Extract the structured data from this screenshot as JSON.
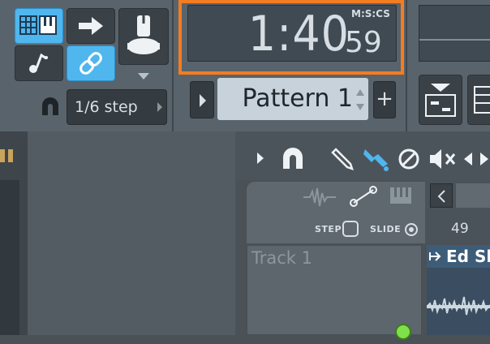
{
  "toolbar": {
    "snap_value": "1/6 step",
    "time_display": {
      "main": "1:40",
      "sub": "59",
      "format": "M:S:CS"
    },
    "pattern": {
      "label": "Pattern 1",
      "add_label": "+"
    }
  },
  "tool_panel": {
    "step_label": "STEP",
    "slide_label": "SLIDE"
  },
  "track": {
    "label": "Track 1"
  },
  "timeline": {
    "bar_number": "49"
  },
  "clip": {
    "title": "Ed Sl"
  },
  "colors": {
    "accent_blue": "#4fb6ee",
    "highlight_orange": "#f47c21"
  }
}
